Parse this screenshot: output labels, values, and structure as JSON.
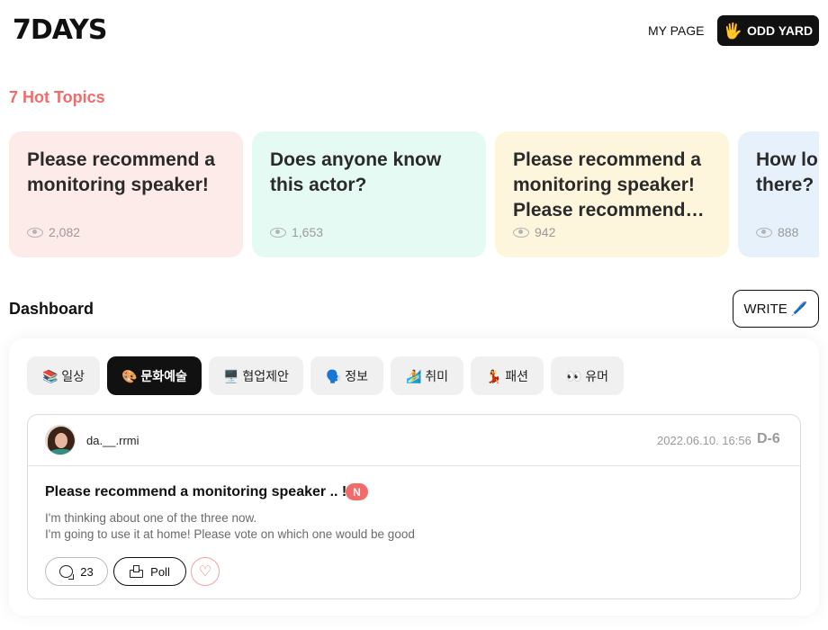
{
  "header": {
    "logo": "7DAYS",
    "mypage_label": "MY PAGE",
    "brand_button_label": "ODD YARD",
    "brand_button_icon": "hand-icon"
  },
  "hot_topics": {
    "title": "7 Hot Topics",
    "cards": [
      {
        "title": "Please recommend a monitoring speaker!",
        "views": "2,082",
        "bg": "#fdebea"
      },
      {
        "title": "Does anyone know this actor?",
        "views": "1,653",
        "bg": "#e6faf4"
      },
      {
        "title": "Please recommend a monitoring speaker! Please recommend a...",
        "views": "942",
        "bg": "#fdf5dc"
      },
      {
        "title": "How long is the film there?",
        "views": "888",
        "bg": "#e6f1fc"
      }
    ]
  },
  "dashboard": {
    "title": "Dashboard",
    "write_label": "WRITE 🖊️",
    "categories": [
      {
        "label": "📚 일상",
        "active": false
      },
      {
        "label": "🎨 문화예술",
        "active": true
      },
      {
        "label": "🖥️ 협업제안",
        "active": false
      },
      {
        "label": "🗣️ 정보",
        "active": false
      },
      {
        "label": "🏄 취미",
        "active": false
      },
      {
        "label": "💃 패션",
        "active": false
      },
      {
        "label": "👀 유머",
        "active": false
      }
    ],
    "post": {
      "username": "da.__.rrmi",
      "date": "2022.06.10. 16:56",
      "dday": "D-6",
      "title": "Please recommend a monitoring speaker .. !",
      "badge": "N",
      "body_line1": "I'm thinking about one of the three now.",
      "body_line2": "I'm going to use it at home! Please vote on which one would be good",
      "comment_count": "23",
      "poll_label": "Poll"
    }
  },
  "colors": {
    "accent": "#f26b6b",
    "dark": "#111111"
  }
}
